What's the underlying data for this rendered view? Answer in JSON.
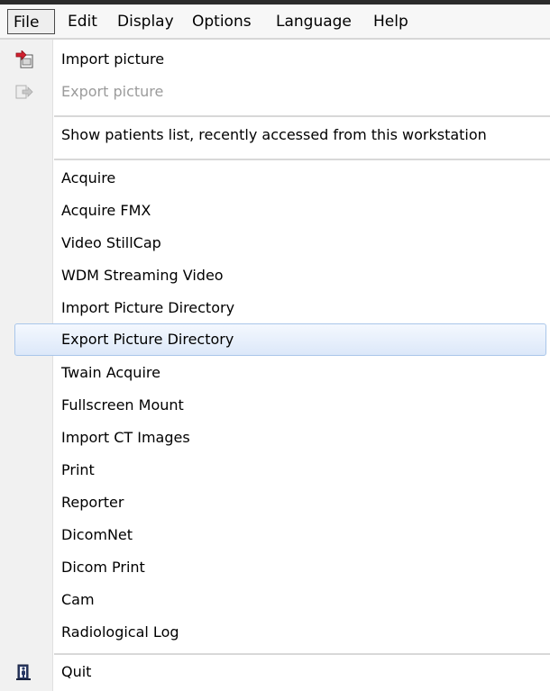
{
  "menubar": {
    "items": [
      {
        "label": "File"
      },
      {
        "label": "Edit"
      },
      {
        "label": "Display"
      },
      {
        "label": "Options"
      },
      {
        "label": "Language"
      },
      {
        "label": "Help"
      }
    ]
  },
  "file_menu": {
    "import_picture": "Import picture",
    "export_picture": "Export picture",
    "show_patients": "Show patients list, recently accessed from this workstation",
    "acquire": "Acquire",
    "acquire_fmx": "Acquire FMX",
    "video_stillcap": "Video StillCap",
    "wdm_streaming": "WDM Streaming Video",
    "import_dir": "Import Picture Directory",
    "export_dir": "Export Picture Directory",
    "twain": "Twain Acquire",
    "fullscreen": "Fullscreen Mount",
    "import_ct": "Import CT Images",
    "print": "Print",
    "reporter": "Reporter",
    "dicomnet": "DicomNet",
    "dicom_print": "Dicom Print",
    "cam": "Cam",
    "radiological_log": "Radiological Log",
    "quit": "Quit"
  },
  "icons": {
    "import": "import-picture-icon",
    "export": "export-picture-icon",
    "quit": "quit-icon"
  },
  "colors": {
    "highlight_border": "#a9c6ea",
    "highlight_fill": "#dce8f9",
    "disabled_text": "#9b9b9b",
    "gutter": "#f1f1f1"
  }
}
